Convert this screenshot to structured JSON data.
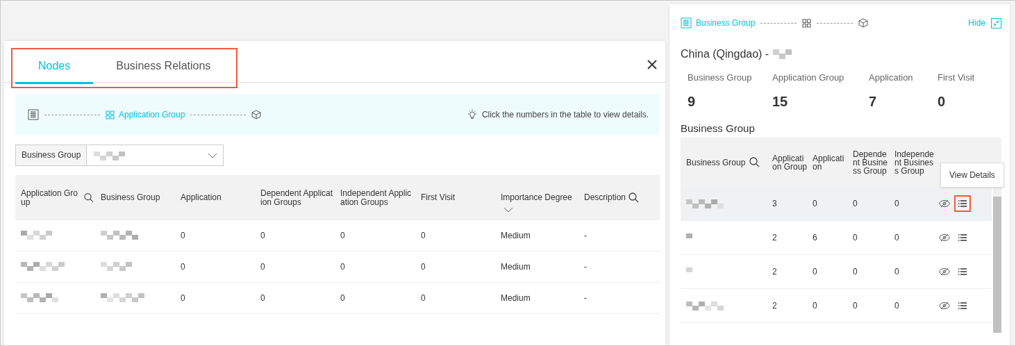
{
  "detail_panel": {
    "tabs_highlighted": true,
    "tabs": [
      {
        "label": "Nodes",
        "selected": true
      },
      {
        "label": "Business Relations",
        "selected": false
      }
    ],
    "breadcrumb": [
      {
        "kind": "table",
        "selected": false
      },
      {
        "kind": "grid",
        "label": "Application Group",
        "selected": true
      },
      {
        "kind": "cube",
        "selected": false
      }
    ],
    "hint": "Click the numbers in the table to view details.",
    "filter": {
      "label": "Business Group",
      "value_blurred": true
    },
    "table": {
      "columns": [
        {
          "label": "Application Group",
          "kind": "search"
        },
        {
          "label": "Business Group",
          "kind": "plain"
        },
        {
          "label": "Application",
          "kind": "plain"
        },
        {
          "label": "Dependent Application Groups",
          "kind": "plain"
        },
        {
          "label": "Independent Application Groups",
          "kind": "plain"
        },
        {
          "label": "First Visit",
          "kind": "plain"
        },
        {
          "label": "Importance Degree",
          "kind": "filter"
        },
        {
          "label": "Description",
          "kind": "search"
        }
      ],
      "rows": [
        {
          "cells": [
            {
              "kind": "blurred"
            },
            {
              "kind": "blurred"
            },
            {
              "kind": "text",
              "text": "0"
            },
            {
              "kind": "text",
              "text": "0"
            },
            {
              "kind": "text",
              "text": "0"
            },
            {
              "kind": "text",
              "text": "0"
            },
            {
              "kind": "text",
              "text": "Medium"
            },
            {
              "kind": "text",
              "text": "-"
            }
          ]
        },
        {
          "cells": [
            {
              "kind": "blurred"
            },
            {
              "kind": "blurred"
            },
            {
              "kind": "text",
              "text": "0"
            },
            {
              "kind": "text",
              "text": "0"
            },
            {
              "kind": "text",
              "text": "0"
            },
            {
              "kind": "text",
              "text": "0"
            },
            {
              "kind": "text",
              "text": "Medium"
            },
            {
              "kind": "text",
              "text": "-"
            }
          ]
        },
        {
          "cells": [
            {
              "kind": "blurred"
            },
            {
              "kind": "blurred"
            },
            {
              "kind": "text",
              "text": "0"
            },
            {
              "kind": "text",
              "text": "0"
            },
            {
              "kind": "text",
              "text": "0"
            },
            {
              "kind": "text",
              "text": "0"
            },
            {
              "kind": "text",
              "text": "Medium"
            },
            {
              "kind": "text",
              "text": "-"
            }
          ]
        }
      ]
    }
  },
  "side_panel": {
    "breadcrumb": [
      {
        "kind": "table",
        "label": "Business Group",
        "selected": true
      },
      {
        "kind": "grid",
        "selected": false
      },
      {
        "kind": "cube",
        "selected": false
      }
    ],
    "hide": "Hide",
    "title": "China (Qingdao) -",
    "title_blurred": true,
    "stats": [
      {
        "label": "Business Group",
        "value": "9"
      },
      {
        "label": "Application Group",
        "value": "15"
      },
      {
        "label": "Application",
        "value": "7"
      },
      {
        "label": "First Visit",
        "value": "0"
      }
    ],
    "section_title": "Business Group",
    "table": {
      "columns": [
        {
          "label": "Business Group",
          "kind": "search"
        },
        {
          "label": "Application Group",
          "kind": "plain"
        },
        {
          "label": "Application",
          "kind": "plain"
        },
        {
          "label": "Dependent Business Group",
          "kind": "plain"
        },
        {
          "label": "Independent Business Group",
          "kind": "plain"
        }
      ],
      "tooltip": "View Details",
      "rows": [
        {
          "hovered": true,
          "details_highlighted": true,
          "cells": [
            {
              "kind": "blurred"
            },
            {
              "kind": "text",
              "text": "3"
            },
            {
              "kind": "text",
              "text": "0"
            },
            {
              "kind": "text",
              "text": "0"
            },
            {
              "kind": "text",
              "text": "0"
            },
            {
              "kind": "actions"
            }
          ]
        },
        {
          "hovered": false,
          "details_highlighted": false,
          "cells": [
            {
              "kind": "blurred"
            },
            {
              "kind": "text",
              "text": "2"
            },
            {
              "kind": "text",
              "text": "6"
            },
            {
              "kind": "text",
              "text": "0"
            },
            {
              "kind": "text",
              "text": "0"
            },
            {
              "kind": "actions"
            }
          ]
        },
        {
          "hovered": false,
          "details_highlighted": false,
          "cells": [
            {
              "kind": "blurred"
            },
            {
              "kind": "text",
              "text": "2"
            },
            {
              "kind": "text",
              "text": "0"
            },
            {
              "kind": "text",
              "text": "0"
            },
            {
              "kind": "text",
              "text": "0"
            },
            {
              "kind": "actions"
            }
          ]
        },
        {
          "hovered": false,
          "details_highlighted": false,
          "cells": [
            {
              "kind": "blurred"
            },
            {
              "kind": "text",
              "text": "2"
            },
            {
              "kind": "text",
              "text": "0"
            },
            {
              "kind": "text",
              "text": "0"
            },
            {
              "kind": "text",
              "text": "0"
            },
            {
              "kind": "actions"
            }
          ]
        }
      ]
    }
  }
}
